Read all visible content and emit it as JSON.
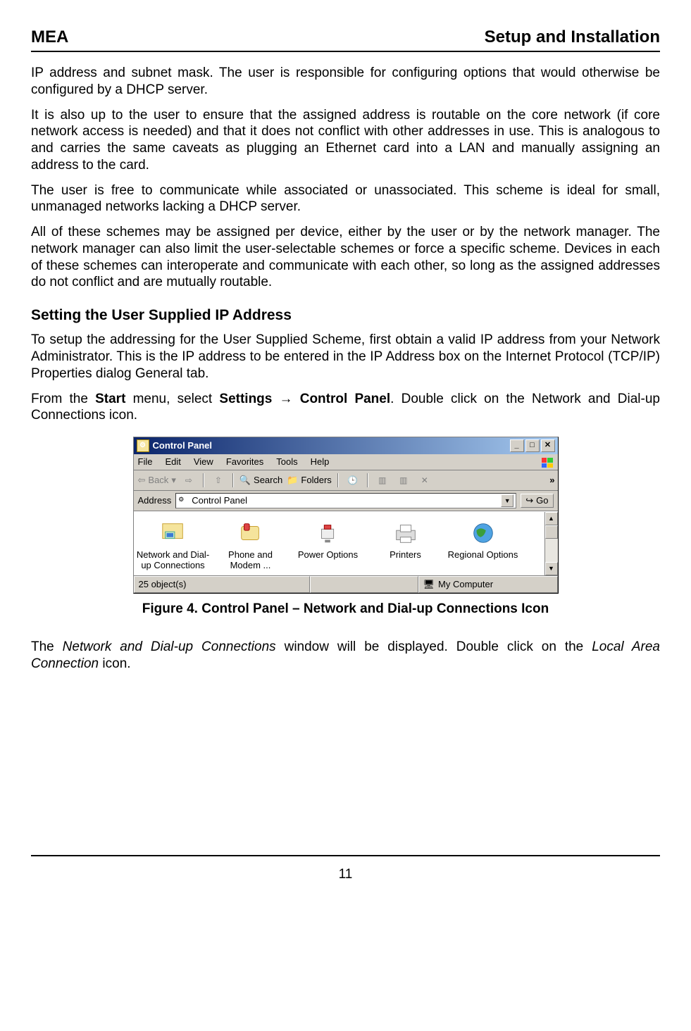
{
  "header": {
    "left": "MEA",
    "right": "Setup and Installation"
  },
  "paras": {
    "p1": "IP address and subnet mask.  The user is responsible for configuring options that would otherwise be configured by a DHCP server.",
    "p2": "It is also up to the user to ensure that the assigned address is routable on the core network (if core network access is needed) and that it does not conflict with other addresses in use.  This is analogous to and carries the same caveats as plugging an Ethernet card into a LAN and manually assigning an address to the card.",
    "p3": "The user is free to communicate while associated or unassociated. This scheme is ideal for small, unmanaged networks lacking a DHCP server.",
    "p4": "All of these schemes may be assigned per device, either by the user or by the network manager.  The network manager can also limit the user-selectable schemes or force a specific scheme.  Devices in each of these schemes can interoperate and communicate with each other, so long as the assigned addresses do not conflict and are mutually routable.",
    "p5a": "To setup the addressing for the User Supplied Scheme, first obtain a valid IP address from your Network Administrator.  This is the IP address to be entered in the IP Address box on the Internet Protocol (TCP/IP) Properties dialog General tab.",
    "p6_pre": "From the ",
    "p6_b1": "Start",
    "p6_mid": " menu, select ",
    "p6_b2": "Settings → Control Panel",
    "p6_post": ".  Double click on the Network and Dial-up Connections icon.",
    "fig": "Figure 4.        Control Panel – Network and Dial-up Connections Icon",
    "p7_pre": "The ",
    "p7_i1": "Network and Dial-up Connections",
    "p7_mid": " window will be displayed.  Double click on the ",
    "p7_i2": "Local Area Connection",
    "p7_post": " icon."
  },
  "section_heading": "Setting the User Supplied IP Address",
  "cp": {
    "title": "Control Panel",
    "menu": [
      "File",
      "Edit",
      "View",
      "Favorites",
      "Tools",
      "Help"
    ],
    "toolbar": {
      "back": "Back",
      "search": "Search",
      "folders": "Folders"
    },
    "address_label": "Address",
    "address_value": "Control Panel",
    "go": "Go",
    "items": [
      {
        "label": "Network and Dial-up Connections"
      },
      {
        "label": "Phone and Modem ..."
      },
      {
        "label": "Power Options"
      },
      {
        "label": "Printers"
      },
      {
        "label": "Regional Options"
      }
    ],
    "status_left": "25 object(s)",
    "status_right": "My Computer"
  },
  "page_number": "11"
}
